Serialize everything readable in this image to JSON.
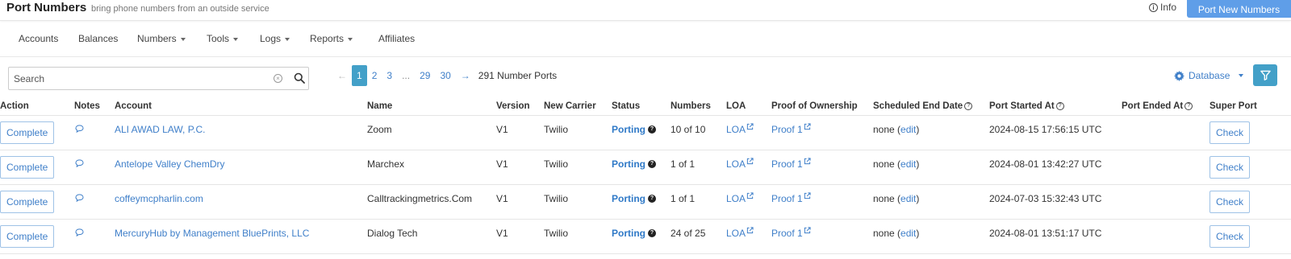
{
  "header": {
    "title": "Port Numbers",
    "subtitle": "bring phone numbers from an outside service",
    "info_label": "Info",
    "port_new_label": "Port New Numbers"
  },
  "nav": {
    "accounts": "Accounts",
    "balances": "Balances",
    "numbers": "Numbers",
    "tools": "Tools",
    "logs": "Logs",
    "reports": "Reports",
    "affiliates": "Affiliates"
  },
  "search": {
    "placeholder": "Search",
    "value": ""
  },
  "pagination": {
    "pages": [
      "1",
      "2",
      "3",
      "...",
      "29",
      "30"
    ],
    "current": "1",
    "total_label": "291 Number Ports"
  },
  "database_label": "Database",
  "table": {
    "headers": {
      "action": "Action",
      "notes": "Notes",
      "account": "Account",
      "name": "Name",
      "version": "Version",
      "carrier": "New Carrier",
      "status": "Status",
      "numbers": "Numbers",
      "loa": "LOA",
      "proof": "Proof of Ownership",
      "scheduled": "Scheduled End Date",
      "started": "Port Started At",
      "ended": "Port Ended At",
      "super": "Super Port"
    },
    "rows": [
      {
        "action": "Complete",
        "account": "ALI AWAD LAW, P.C.",
        "name": "Zoom",
        "version": "V1",
        "carrier": "Twilio",
        "status": "Porting",
        "numbers": "10 of 10",
        "loa": "LOA",
        "proof": "Proof 1",
        "scheduled_prefix": "none (",
        "scheduled_edit": "edit",
        "scheduled_suffix": ")",
        "started": "2024-08-15 17:56:15 UTC",
        "ended": "",
        "super": "Check"
      },
      {
        "action": "Complete",
        "account": "Antelope Valley ChemDry",
        "name": "Marchex",
        "version": "V1",
        "carrier": "Twilio",
        "status": "Porting",
        "numbers": "1 of 1",
        "loa": "LOA",
        "proof": "Proof 1",
        "scheduled_prefix": "none (",
        "scheduled_edit": "edit",
        "scheduled_suffix": ")",
        "started": "2024-08-01 13:42:27 UTC",
        "ended": "",
        "super": "Check"
      },
      {
        "action": "Complete",
        "account": "coffeymcpharlin.com",
        "name": "Calltrackingmetrics.Com",
        "version": "V1",
        "carrier": "Twilio",
        "status": "Porting",
        "numbers": "1 of 1",
        "loa": "LOA",
        "proof": "Proof 1",
        "scheduled_prefix": "none (",
        "scheduled_edit": "edit",
        "scheduled_suffix": ")",
        "started": "2024-07-03 15:32:43 UTC",
        "ended": "",
        "super": "Check"
      },
      {
        "action": "Complete",
        "account": "MercuryHub by Management BluePrints, LLC",
        "name": "Dialog Tech",
        "version": "V1",
        "carrier": "Twilio",
        "status": "Porting",
        "numbers": "24 of 25",
        "loa": "LOA",
        "proof": "Proof 1",
        "scheduled_prefix": "none (",
        "scheduled_edit": "edit",
        "scheduled_suffix": ")",
        "started": "2024-08-01 13:51:17 UTC",
        "ended": "",
        "super": "Check"
      }
    ]
  },
  "icons": {
    "info": "info-icon",
    "search": "search-icon",
    "clear": "clear-icon",
    "gear": "gear-icon",
    "filter": "filter-icon",
    "note": "note-icon",
    "external": "external-link-icon",
    "help": "question-icon"
  },
  "colors": {
    "primary_button": "#5f9ee8",
    "active_page": "#43a0c8",
    "link": "#3f7fc9"
  }
}
